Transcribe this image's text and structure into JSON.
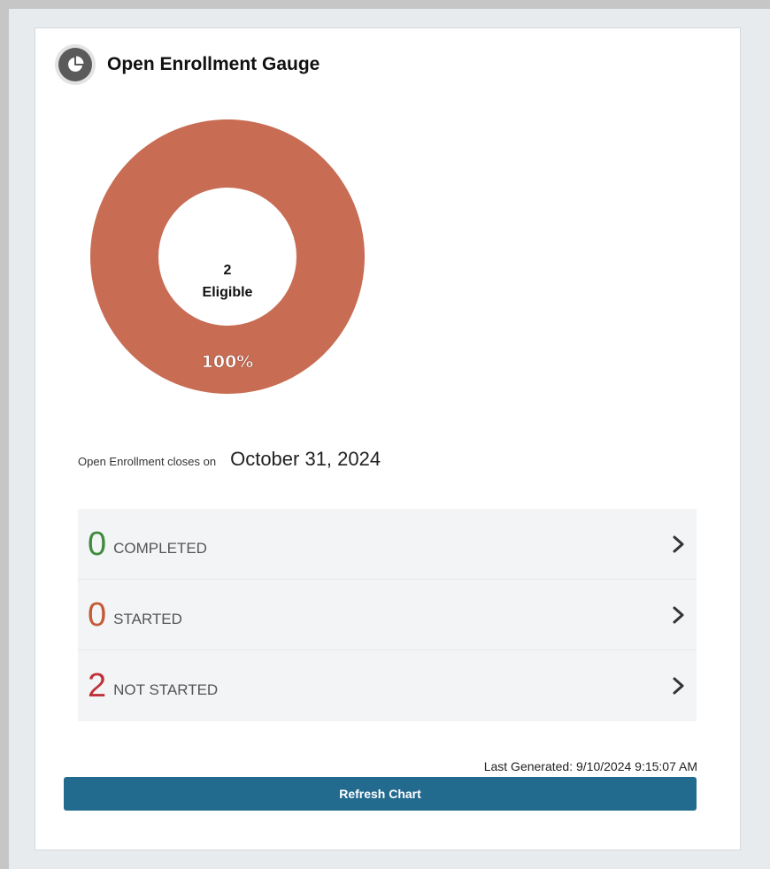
{
  "header": {
    "title": "Open Enrollment Gauge",
    "icon": "pie-chart-icon"
  },
  "chart_data": {
    "type": "pie",
    "categories": [
      "Not Started"
    ],
    "values": [
      100
    ],
    "value_labels": [
      "100%"
    ],
    "center": {
      "count": "2",
      "label": "Eligible"
    },
    "color": "#c86c53"
  },
  "enrollment": {
    "close_label": "Open Enrollment closes on",
    "close_date": "October 31, 2024"
  },
  "statuses": [
    {
      "count": "0",
      "label": "COMPLETED",
      "color": "#3f8a3f"
    },
    {
      "count": "0",
      "label": "STARTED",
      "color": "#c45a36"
    },
    {
      "count": "2",
      "label": "NOT STARTED",
      "color": "#c0323a"
    }
  ],
  "footer": {
    "last_generated": "Last Generated: 9/10/2024 9:15:07 AM",
    "refresh_label": "Refresh Chart",
    "button_color": "#236a8f"
  }
}
